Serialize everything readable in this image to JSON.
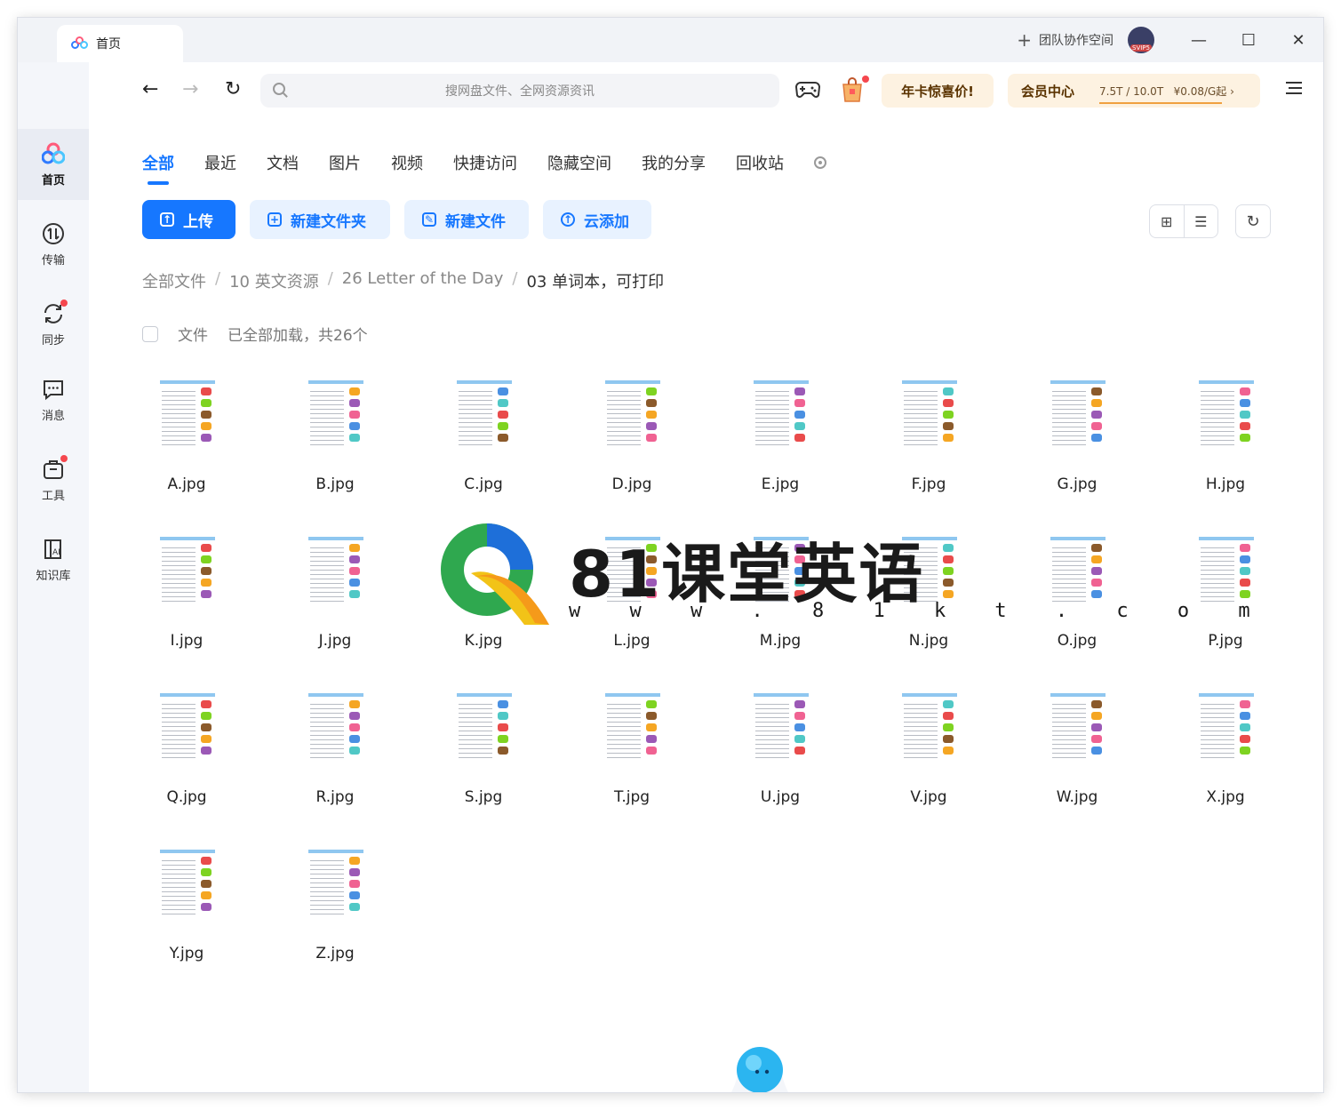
{
  "titlebar": {
    "tab_label": "首页",
    "team_label": "团队协作空间",
    "avatar_badge": "SVIP5"
  },
  "sidebar": {
    "items": [
      {
        "label": "首页",
        "icon": "cloud-logo-icon"
      },
      {
        "label": "传输",
        "icon": "transfer-icon"
      },
      {
        "label": "同步",
        "icon": "sync-icon"
      },
      {
        "label": "消息",
        "icon": "message-icon"
      },
      {
        "label": "工具",
        "icon": "toolbox-icon"
      },
      {
        "label": "知识库",
        "icon": "knowledge-base-icon"
      }
    ]
  },
  "toolbar": {
    "search_placeholder": "搜网盘文件、全网资源资讯",
    "promo_label": "年卡惊喜价!",
    "vip_label": "会员中心",
    "vip_storage": "7.5T / 10.0T",
    "vip_price": "¥0.08/G起"
  },
  "categories": [
    "全部",
    "最近",
    "文档",
    "图片",
    "视频",
    "快捷访问",
    "隐藏空间",
    "我的分享",
    "回收站"
  ],
  "actions": {
    "upload": "上传",
    "new_folder": "新建文件夹",
    "new_file": "新建文件",
    "cloud_add": "云添加"
  },
  "breadcrumb": [
    "全部文件",
    "10 英文资源",
    "26 Letter of the Day",
    "03 单词本，可打印"
  ],
  "list_header": {
    "column": "文件",
    "status": "已全部加载，共26个"
  },
  "files": [
    "A.jpg",
    "B.jpg",
    "C.jpg",
    "D.jpg",
    "E.jpg",
    "F.jpg",
    "G.jpg",
    "H.jpg",
    "I.jpg",
    "J.jpg",
    "K.jpg",
    "L.jpg",
    "M.jpg",
    "N.jpg",
    "O.jpg",
    "P.jpg",
    "Q.jpg",
    "R.jpg",
    "S.jpg",
    "T.jpg",
    "U.jpg",
    "V.jpg",
    "W.jpg",
    "X.jpg",
    "Y.jpg",
    "Z.jpg"
  ],
  "watermark": {
    "title": "81课堂英语",
    "url": "w w w . 8 1 k t . c o m"
  },
  "colors": {
    "accent": "#1677ff",
    "promo_bg": "#fdf2e1",
    "badge_red": "#f5474e"
  }
}
